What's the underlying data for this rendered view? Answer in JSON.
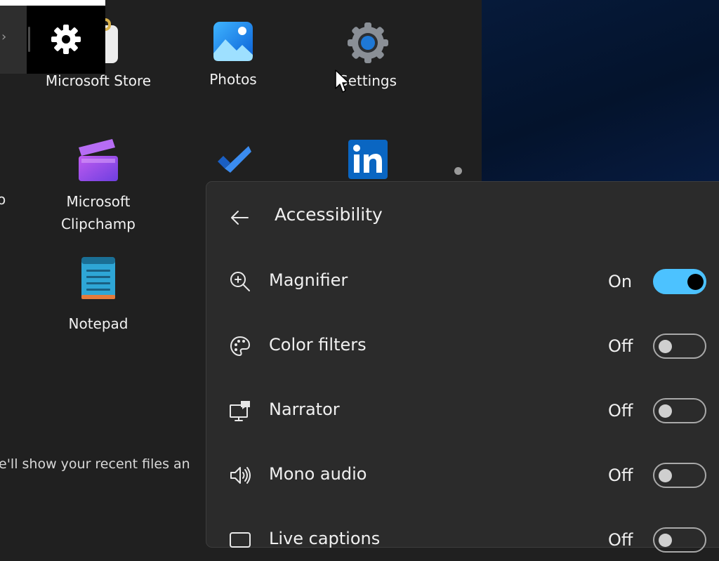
{
  "start_menu": {
    "pinned_apps": [
      {
        "name": "Microsoft Store",
        "icon": "microsoft-store-icon"
      },
      {
        "name": "Photos",
        "icon": "photos-icon"
      },
      {
        "name": "Settings",
        "icon": "settings-icon"
      },
      {
        "name": "Microsoft Clipchamp",
        "name_line1": "Microsoft",
        "name_line2": "Clipchamp",
        "icon": "clipchamp-icon"
      },
      {
        "name": "",
        "icon": "todo-icon"
      },
      {
        "name": "",
        "icon": "linkedin-icon"
      },
      {
        "name": "Notepad",
        "icon": "notepad-icon"
      }
    ],
    "partial_left_label": "o",
    "recommended_text": "e'll show your recent files an",
    "tooltip": {
      "icon": "gear-icon",
      "prev_chevron": "›"
    }
  },
  "accessibility_flyout": {
    "back_icon": "back-arrow-icon",
    "title": "Accessibility",
    "items": [
      {
        "label": "Magnifier",
        "state": "On",
        "on": true,
        "icon": "magnifier-icon"
      },
      {
        "label": "Color filters",
        "state": "Off",
        "on": false,
        "icon": "color-filters-icon"
      },
      {
        "label": "Narrator",
        "state": "Off",
        "on": false,
        "icon": "narrator-icon"
      },
      {
        "label": "Mono audio",
        "state": "Off",
        "on": false,
        "icon": "mono-audio-icon"
      },
      {
        "label": "Live captions",
        "state": "Off",
        "on": false,
        "icon": "live-captions-icon"
      }
    ]
  },
  "colors": {
    "accent": "#4cc2ff",
    "panel": "#2b2b2b",
    "background": "#202020",
    "desktop": "#061a3a"
  }
}
